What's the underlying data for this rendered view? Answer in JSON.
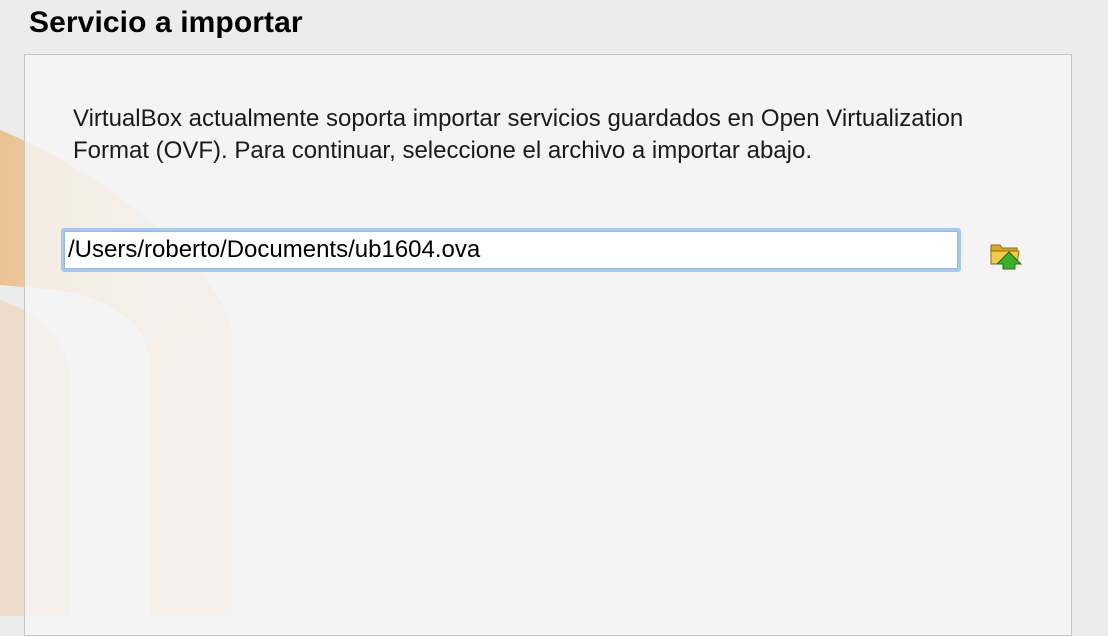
{
  "page": {
    "title": "Servicio a importar",
    "description": "VirtualBox actualmente soporta importar servicios guardados en Open Virtualization Format (OVF). Para continuar, seleccione el archivo a importar abajo."
  },
  "file_field": {
    "value": "/Users/roberto/Documents/ub1604.ova",
    "browse_icon": "folder-open-icon"
  },
  "colors": {
    "background": "#ececec",
    "panel": "#f6f6f6",
    "focus_ring": "#a9c8ee",
    "folder_yellow": "#f2c94c",
    "arrow_green": "#3fae2a"
  }
}
